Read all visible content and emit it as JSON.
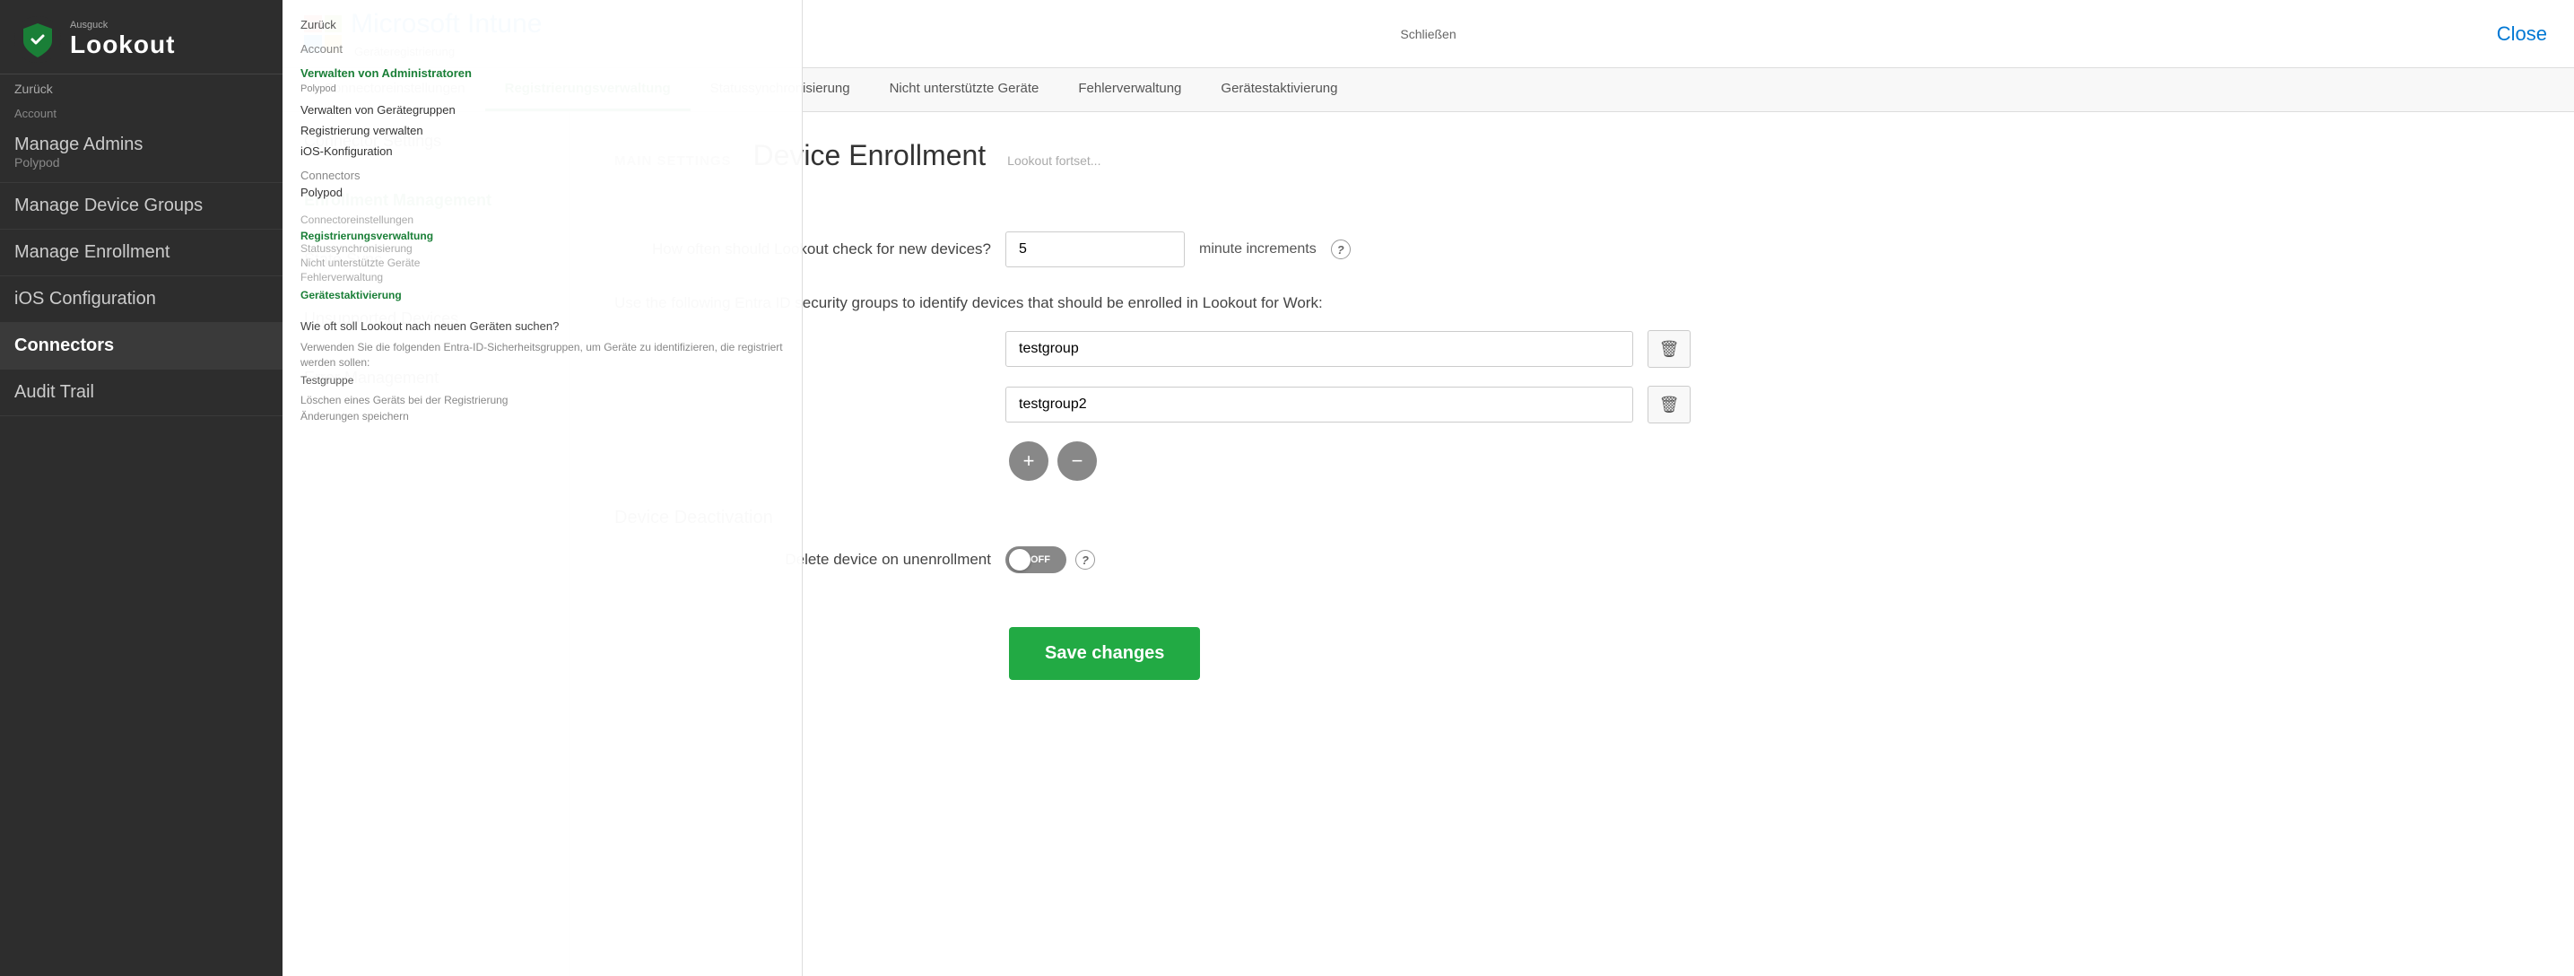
{
  "app": {
    "title": "Ausguck",
    "logo_text": "Lookout",
    "close_label": "Close",
    "schlieben": "Schließen"
  },
  "sidebar": {
    "back_label": "Zurück",
    "account_label": "Account",
    "manage_admins_label": "Manage Admins",
    "manage_admins_sub": "Polypod",
    "manage_device_groups_label": "Manage Device Groups",
    "manage_enrollment_label": "Manage Enrollment",
    "ios_config_label": "iOS Configuration",
    "connectors_label": "Connectors",
    "audit_trail_label": "Audit Trail",
    "items": [
      {
        "label": "Manage Admins",
        "id": "manage-admins"
      },
      {
        "label": "Manage Device Groups",
        "id": "manage-device-groups"
      },
      {
        "label": "Manage Enrollment",
        "id": "manage-enrollment"
      },
      {
        "label": "iOS Configuration",
        "id": "ios-config"
      },
      {
        "label": "Connectors",
        "id": "connectors",
        "active": true
      },
      {
        "label": "Audit Trail",
        "id": "audit-trail"
      }
    ]
  },
  "intune_header": {
    "title": "Microsoft Intune",
    "subtitle": "Geräteregistrierung",
    "close_label": "Close"
  },
  "sub_nav": {
    "items": [
      {
        "label": "Connectoreinstellungen",
        "id": "connector-settings"
      },
      {
        "label": "Registrierungsverwaltung",
        "id": "enrollment-management",
        "active": true
      },
      {
        "label": "Statussynchronisierung",
        "id": "state-sync"
      },
      {
        "label": "Nicht unterstützte Geräte",
        "id": "unsupported-devices"
      },
      {
        "label": "Fehlerverwaltung",
        "id": "error-management"
      },
      {
        "label": "Gerätestaktivierung",
        "id": "device-deactivation"
      }
    ]
  },
  "left_panel": {
    "items": [
      {
        "label": "Connector Settings",
        "id": "connector-settings"
      },
      {
        "label": "Enrollment Management",
        "id": "enrollment-management",
        "active": true
      },
      {
        "label": "State Sync",
        "id": "state-sync"
      },
      {
        "label": "Unsupported Devices",
        "id": "unsupported-devices"
      },
      {
        "label": "Error Management",
        "id": "error-management"
      }
    ]
  },
  "main": {
    "title": "Device Enrollment",
    "main_settings_label": "MAIN SETTINGS",
    "lookout_fortsett": "Lookout fortset...",
    "how_often_label": "How often should Lookout check for new devices?",
    "minute_increments": "minute increments",
    "interval_value": "5",
    "entra_label": "Use the following Entra ID security groups to identify devices that should be enrolled in Lookout for Work:",
    "group1_value": "testgroup",
    "group2_value": "testgroup2",
    "device_deactivation_label": "Device Deactivation",
    "delete_device_label": "Delete device on unenrollment",
    "toggle_state": "OFF",
    "save_changes_label": "Save changes",
    "wie_oft_label": "Wie oft soll Lookout nach neuen Geräten suchen?",
    "verwenden_label": "Verwenden Sie die folgenden Entra-ID-Sicherheitsgruppen, um Geräte zu identifizieren, die registriert werden sollen:",
    "testgruppe_label": "Testgruppe",
    "loeschen_label": "Löschen eines Geräts bei der Registrierung",
    "aenderungen_label": "Änderungen speichern"
  },
  "icons": {
    "add": "+",
    "remove": "−",
    "delete": "🗑",
    "help": "?",
    "windows_colors": [
      "#f25022",
      "#7fba00",
      "#00a4ef",
      "#ffb900"
    ]
  }
}
